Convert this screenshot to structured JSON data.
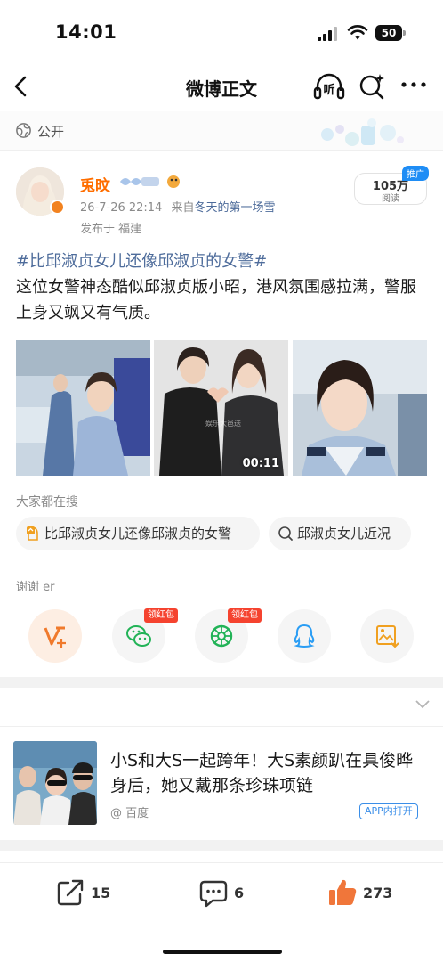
{
  "status_bar": {
    "time": "14:01",
    "battery": "50"
  },
  "nav": {
    "title": "微博正文",
    "listen_label": "听",
    "icons": [
      "back-arrow-icon",
      "headphones-icon",
      "search-sparkle-icon",
      "more-dots-icon"
    ]
  },
  "visibility": {
    "label": "公开",
    "icon": "globe-icon"
  },
  "post": {
    "author": {
      "name": "兎旼",
      "verified": true
    },
    "meta": {
      "timestamp": "26-7-26 22:14",
      "source_prefix": "来自",
      "source": "冬天的第一场雪",
      "location": "发布于 福建"
    },
    "reads": {
      "count": "105万",
      "label": "阅读",
      "promo_tag": "推广"
    },
    "hashtag": "#比邱淑贞女儿还像邱淑贞的女警#",
    "text": "这位女警神态酷似邱淑贞版小昭，港风氛围感拉满，警服上身又飒又有气质。",
    "media": [
      {
        "kind": "image",
        "description_icon": "photo-icon"
      },
      {
        "kind": "video",
        "duration": "00:11",
        "watermark": "娱乐大邑送"
      },
      {
        "kind": "image",
        "description_icon": "photo-icon"
      }
    ]
  },
  "search": {
    "title": "大家都在搜",
    "chips": [
      {
        "text": "比邱淑贞女儿还像邱淑贞的女警",
        "icon": "hot-search-icon"
      },
      {
        "text": "邱淑贞女儿近况",
        "icon": "search-icon"
      }
    ]
  },
  "share": {
    "label": "谢谢 er",
    "redpacket_tag": "领红包",
    "targets": [
      "vip-share-icon",
      "wechat-icon",
      "moments-icon",
      "qq-icon",
      "save-image-icon"
    ]
  },
  "news": {
    "title": "小S和大S一起跨年！大S素颜趴在具俊晔身后，她又戴那条珍珠项链",
    "source": "@ 百度",
    "app_tag": "APP内打开"
  },
  "actions": {
    "reposts": "15",
    "comments": "6",
    "likes": "273"
  },
  "colors": {
    "accent_orange": "#ff6e00",
    "link_blue": "#4e6c9b",
    "redpacket_red": "#f5432f",
    "like_orange": "#f0763a",
    "app_tag_blue": "#3a8ee8"
  }
}
